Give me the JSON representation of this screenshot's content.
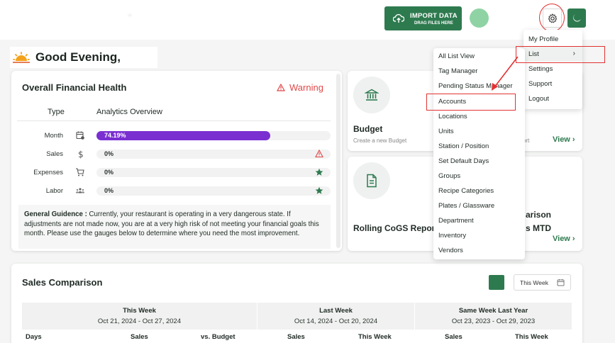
{
  "header": {
    "import_title": "IMPORT DATA",
    "import_subtitle": "DRAG FILES HERE"
  },
  "greeting": {
    "text": "Good Evening,"
  },
  "health": {
    "title": "Overall Financial Health",
    "status": "Warning",
    "col_type": "Type",
    "col_analytics": "Analytics Overview",
    "rows": [
      {
        "label": "Month",
        "icon": "calendar-icon",
        "value": "74.19%",
        "fraction": 0.7419,
        "status_icon": ""
      },
      {
        "label": "Sales",
        "icon": "dollar-icon",
        "value": "0%",
        "fraction": 0,
        "status_icon": "warning-icon"
      },
      {
        "label": "Expenses",
        "icon": "cart-icon",
        "value": "0%",
        "fraction": 0,
        "status_icon": "star-icon"
      },
      {
        "label": "Labor",
        "icon": "people-icon",
        "value": "0%",
        "fraction": 0,
        "status_icon": "star-icon"
      }
    ],
    "guidance_label": "General Guidence :",
    "guidance_text": "Currently, your restaurant is operating in a very dangerous state. If adjustments are not made now, you are at a very high risk of not meeting your financial goals this month. Please use the gauges below to determine where you need the most improvement."
  },
  "budget": {
    "title": "Budget",
    "subtitle": "Create a new Budget",
    "partial": "ort",
    "view": "View ›"
  },
  "rolling": {
    "title": "Rolling CoGS Repor",
    "partial_line1": "arison",
    "partial_line2": "s MTD",
    "view": "View ›"
  },
  "sales": {
    "title": "Sales Comparison",
    "week_select": "This Week",
    "groups": [
      {
        "label": "This Week",
        "range": "Oct 21, 2024 - Oct 27, 2024"
      },
      {
        "label": "Last Week",
        "range": "Oct 14, 2024 - Oct 20, 2024"
      },
      {
        "label": "Same Week Last Year",
        "range": "Oct 23, 2023 - Oct 29, 2023"
      }
    ],
    "columns": [
      "Days",
      "Sales",
      "vs. Budget",
      "Sales",
      "This Week",
      "Sales",
      "This Week"
    ]
  },
  "menu": {
    "items": [
      "My Profile",
      "List",
      "Settings",
      "Support",
      "Logout"
    ],
    "caret": "›"
  },
  "submenu": {
    "items": [
      "All List View",
      "Tag Manager",
      "Pending Status Manager",
      "Accounts",
      "Locations",
      "Units",
      "Station / Position",
      "Set Default Days",
      "Groups",
      "Recipe Categories",
      "Plates / Glassware",
      "Department",
      "Inventory",
      "Vendors"
    ]
  },
  "colors": {
    "brand_green": "#2e7a4f",
    "progress_purple": "#7a2fd1",
    "warning_red": "#e04848",
    "annotation_red": "#e23232"
  }
}
